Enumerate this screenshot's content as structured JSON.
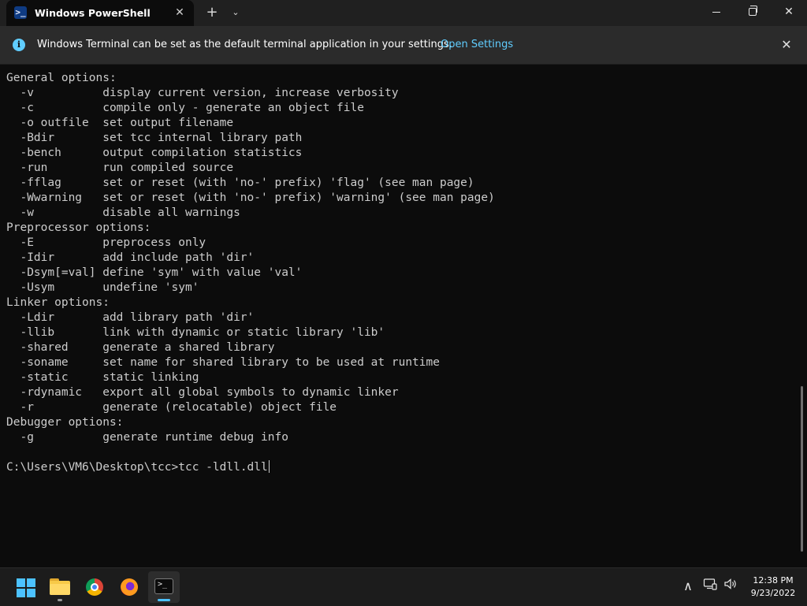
{
  "window": {
    "tab_title": "Windows PowerShell",
    "tab_icon": "powershell-icon",
    "tab_close_icon": "close-icon",
    "new_tab_icon": "plus-icon",
    "dropdown_icon": "chevron-down-icon",
    "minimize_icon": "minimize-icon",
    "maximize_icon": "restore-icon",
    "close_icon": "close-icon"
  },
  "infobar": {
    "icon": "info-icon",
    "message": "Windows Terminal can be set as the default terminal application in your settings.",
    "link": "Open Settings",
    "close_icon": "close-icon"
  },
  "terminal": {
    "lines": [
      "General options:",
      "  -v          display current version, increase verbosity",
      "  -c          compile only - generate an object file",
      "  -o outfile  set output filename",
      "  -Bdir       set tcc internal library path",
      "  -bench      output compilation statistics",
      "  -run        run compiled source",
      "  -fflag      set or reset (with 'no-' prefix) 'flag' (see man page)",
      "  -Wwarning   set or reset (with 'no-' prefix) 'warning' (see man page)",
      "  -w          disable all warnings",
      "Preprocessor options:",
      "  -E          preprocess only",
      "  -Idir       add include path 'dir'",
      "  -Dsym[=val] define 'sym' with value 'val'",
      "  -Usym       undefine 'sym'",
      "Linker options:",
      "  -Ldir       add library path 'dir'",
      "  -llib       link with dynamic or static library 'lib'",
      "  -shared     generate a shared library",
      "  -soname     set name for shared library to be used at runtime",
      "  -static     static linking",
      "  -rdynamic   export all global symbols to dynamic linker",
      "  -r          generate (relocatable) object file",
      "Debugger options:",
      "  -g          generate runtime debug info",
      ""
    ],
    "prompt": "C:\\Users\\VM6\\Desktop\\tcc>",
    "command": "tcc -ldll.dll"
  },
  "taskbar": {
    "apps": [
      {
        "name": "start",
        "icon": "windows-start-icon"
      },
      {
        "name": "file-explorer",
        "icon": "folder-icon"
      },
      {
        "name": "chrome",
        "icon": "chrome-icon"
      },
      {
        "name": "firefox",
        "icon": "firefox-icon"
      },
      {
        "name": "terminal",
        "icon": "terminal-icon",
        "active": true
      }
    ],
    "tray": {
      "chevron_icon": "chevron-up-icon",
      "network_icon": "network-icon",
      "volume_icon": "volume-icon"
    },
    "clock": {
      "time": "12:38 PM",
      "date": "9/23/2022"
    }
  },
  "colors": {
    "terminal_bg": "#0c0c0c",
    "terminal_fg": "#cccccc",
    "accent": "#60cdff",
    "taskbar_bg": "#1c1c1c"
  }
}
